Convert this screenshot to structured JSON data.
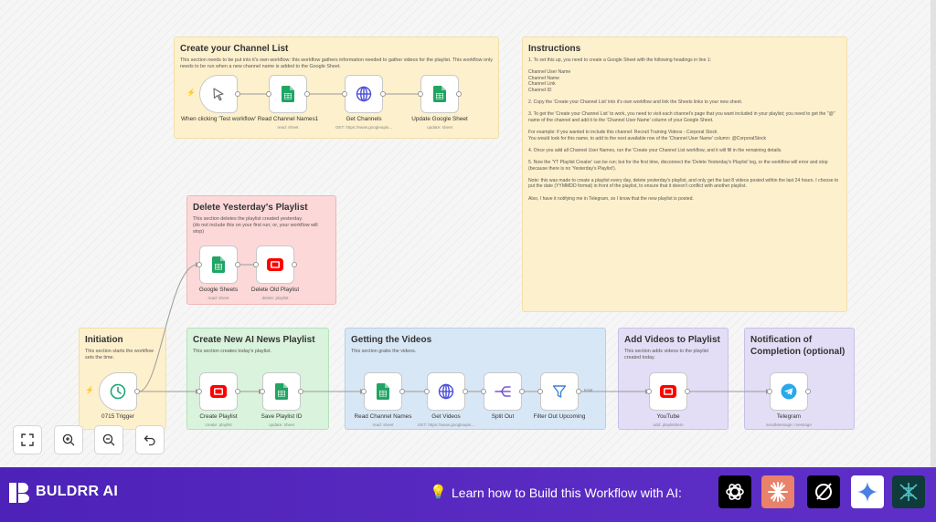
{
  "stickies": {
    "channel_list": {
      "title": "Create your Channel List",
      "body": "This section needs to be put into it's own workflow: this workflow gathers information needed to gather videos for the playlist. This workflow only needs to be run when a new channel name is added to the Google Sheet."
    },
    "instructions": {
      "title": "Instructions",
      "body": "1. To set this up, you need to create a Google Sheet with the following headings in line 1:\n\n     Channel User Name\n     Channel Name\n     Channel Link\n     Channel ID\n\n2. Copy the 'Create your Channel List' into it's own workflow and link the Sheets links to your new sheet.\n\n3. To get the 'Create your Channel List' to work, you need to visit each channel's page that you want included in your playlist; you need to get the \"@\" name of the channel and add it to the 'Channel User Name' column of your Google Sheet.\n\n     For example: if you wanted to include this channel: Recruit Training Videos - Corporal Stock\n     You would look for this name, to add to the next available row of the 'Channel User Name' column: @CorporalStock\n\n4. Once you add all Channel User Names, run the 'Create your Channel List workflow, and it will fill in the remaining details.\n\n5. Now the 'YT Playlist Creator' can be run; but for the first time, disconnect the 'Delete Yesterday's Playlist' leg, or the workflow will error and stop (because there is no 'Yesterday's Playlist').\n\n     Note: this was made to create a playlist every day, delete yesterday's playlist, and only get the last 8 videos posted within the last 24 hours. I choose to put the date (YYMMDD format) in front of the playlist, to ensure that it doesn't conflict with another playlist.\n\n     Also, I have it notifying me in Telegram, so I know that the new playlist is posted."
    },
    "delete_playlist": {
      "title": "Delete Yesterday's Playlist",
      "body": "This section deletes the playlist created yesterday.\n(do not include this on your first run; or, your workflow will stop)"
    },
    "initiation": {
      "title": "Initiation",
      "body": "This section starts the workflow sets the time."
    },
    "create_playlist": {
      "title": "Create New AI News Playlist",
      "body": "This section creates today's playlist."
    },
    "getting_videos": {
      "title": "Getting the Videos",
      "body": "This section grabs the videos."
    },
    "add_videos": {
      "title": "Add Videos to Playlist",
      "body": "This section adds videos to the playlist created today."
    },
    "notification": {
      "title": "Notification of Completion (optional)",
      "body": ""
    }
  },
  "nodes": {
    "manual_trigger": {
      "label": "When clicking 'Test workflow'",
      "sub": "",
      "icon": "cursor-icon"
    },
    "read_channel_names1": {
      "label": "Read Channel Names1",
      "sub": "read: sheet",
      "icon": "google-sheets-icon"
    },
    "get_channels": {
      "label": "Get Channels",
      "sub": "GET: https://www.googleapis...",
      "icon": "globe-icon"
    },
    "update_google_sheet": {
      "label": "Update Google Sheet",
      "sub": "update: sheet",
      "icon": "google-sheets-icon"
    },
    "google_sheets": {
      "label": "Google Sheets",
      "sub": "read: sheet",
      "icon": "google-sheets-icon"
    },
    "delete_old_playlist": {
      "label": "Delete Old Playlist",
      "sub": "delete: playlist",
      "icon": "youtube-icon"
    },
    "trigger_0715": {
      "label": "0715 Trigger",
      "sub": "",
      "icon": "clock-icon"
    },
    "create_playlist": {
      "label": "Create Playlist",
      "sub": "create: playlist",
      "icon": "youtube-icon"
    },
    "save_playlist_id": {
      "label": "Save Playlist ID",
      "sub": "update: sheet",
      "icon": "google-sheets-icon"
    },
    "read_channel_names": {
      "label": "Read Channel Names",
      "sub": "read: sheet",
      "icon": "google-sheets-icon"
    },
    "get_videos": {
      "label": "Get Videos",
      "sub": "GET: https://www.googleapis...",
      "icon": "globe-icon"
    },
    "split_out": {
      "label": "Split Out",
      "sub": "",
      "icon": "split-out-icon"
    },
    "filter_out_upcoming": {
      "label": "Filter Out Upcoming",
      "sub": "",
      "icon": "filter-icon"
    },
    "youtube": {
      "label": "YouTube",
      "sub": "add: playlistItem",
      "icon": "youtube-icon"
    },
    "telegram": {
      "label": "Telegram",
      "sub": "sendMessage: message",
      "icon": "telegram-icon"
    }
  },
  "edge_labels": {
    "filter_kept": "Kept"
  },
  "controls": [
    "fit-view-icon",
    "zoom-in-icon",
    "zoom-out-icon",
    "undo-icon"
  ],
  "banner": {
    "brand": "BULDRR AI",
    "cta": "Learn how to Build this Workflow with AI:",
    "tiles": [
      "chatgpt-icon",
      "claude-icon",
      "perplexity-icon",
      "gemini-icon",
      "deepseek-icon"
    ]
  },
  "colors": {
    "sticky_yellow": "#fdf0cc",
    "sticky_pink": "#fcd8d8",
    "sticky_green": "#d9f3dc",
    "sticky_blue": "#d8e7f6",
    "sticky_purple": "#e3def6",
    "trigger_bolt": "#ff6d5a",
    "banner": "#5a2bc2"
  }
}
